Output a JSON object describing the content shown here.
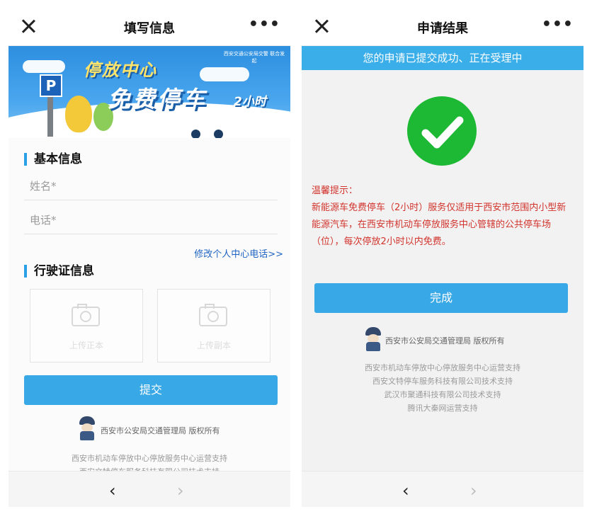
{
  "left": {
    "title": "填写信息",
    "more": "•••",
    "banner": {
      "small_text": "西安交通公安局交警 联合发起",
      "line1": "停放中心",
      "line2": "免费停车",
      "line3": "2小时",
      "p_sign": "P"
    },
    "basic_section": "基本信息",
    "name_label": "姓名*",
    "phone_label": "电话*",
    "modify_link": "修改个人中心电话>>",
    "license_section": "行驶证信息",
    "upload1": "上传正本",
    "upload2": "上传副本",
    "submit": "提交",
    "copyright": "西安市公安局交通管理局  版权所有",
    "sponsor1": "西安市机动车停放中心停放服务中心运营支持",
    "sponsor2": "西安文特停车服务科技有限公司技术支持"
  },
  "right": {
    "title": "申请结果",
    "more": "•••",
    "notice": "您的申请已提交成功、正在受理中",
    "tip_head": "温馨提示：",
    "tip_body": "新能源车免费停车（2小时）服务仅适用于西安市范围内小型新能源汽车，在西安市机动车停放服务中心管辖的公共停车场（位），每次停放2小时以内免费。",
    "done": "完成",
    "copyright": "西安市公安局交通管理局  版权所有",
    "sponsor1": "西安市机动车停放中心停放服务中心运营支持",
    "sponsor2": "西安文特停车服务科技有限公司技术支持",
    "sponsor3": "武汉市聚通科技有限公司技术支持",
    "sponsor4": "腾讯大秦网运营支持"
  },
  "nav": {
    "prev": "‹",
    "next": "›"
  },
  "colors": {
    "accent": "#39a8e6",
    "success": "#1db934",
    "warning_text": "#d2342d",
    "link": "#1f64c2"
  }
}
